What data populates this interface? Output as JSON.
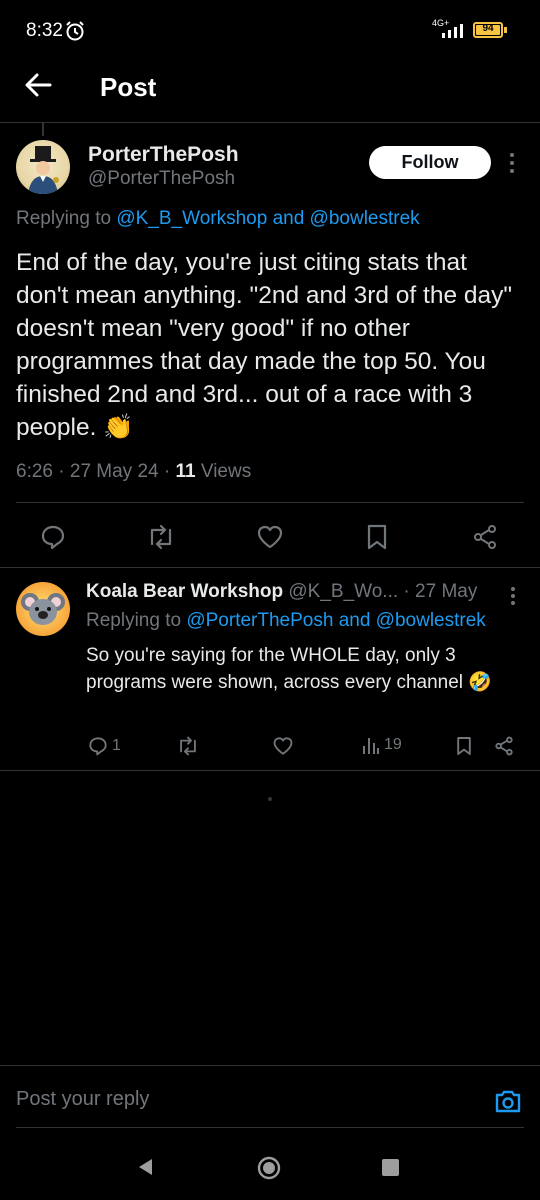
{
  "status_bar": {
    "time": "8:32",
    "network": "4G+",
    "battery": "94"
  },
  "header": {
    "title": "Post"
  },
  "post": {
    "display_name": "PorterThePosh",
    "handle": "@PorterThePosh",
    "follow_label": "Follow",
    "replying_prefix": "Replying to",
    "replying_users": "@K_B_Workshop and @bowlestrek",
    "text": "End of the day, you're just citing stats that don't mean anything. \"2nd and 3rd of the day\" doesn't mean \"very good\" if no other programmes that day made the top 50. You finished 2nd and 3rd... out of a race with 3 people. 👏",
    "time": "6:26",
    "date": "27 May 24",
    "views_count": "11",
    "views_label": "Views"
  },
  "reply": {
    "display_name": "Koala Bear Workshop",
    "handle": "@K_B_Wo...",
    "date": "· 27 May",
    "replying_prefix": "Replying to",
    "replying_users": "@PorterThePosh and @bowlestrek",
    "text": "So you're saying for the WHOLE day, only 3 programs were shown, across every channel 🤣",
    "reply_count": "1",
    "views_count": "19"
  },
  "composer": {
    "placeholder": "Post your reply"
  },
  "colors": {
    "accent": "#1d9bf0",
    "background": "#000000",
    "muted": "#71767b",
    "battery": "#f6c343"
  }
}
